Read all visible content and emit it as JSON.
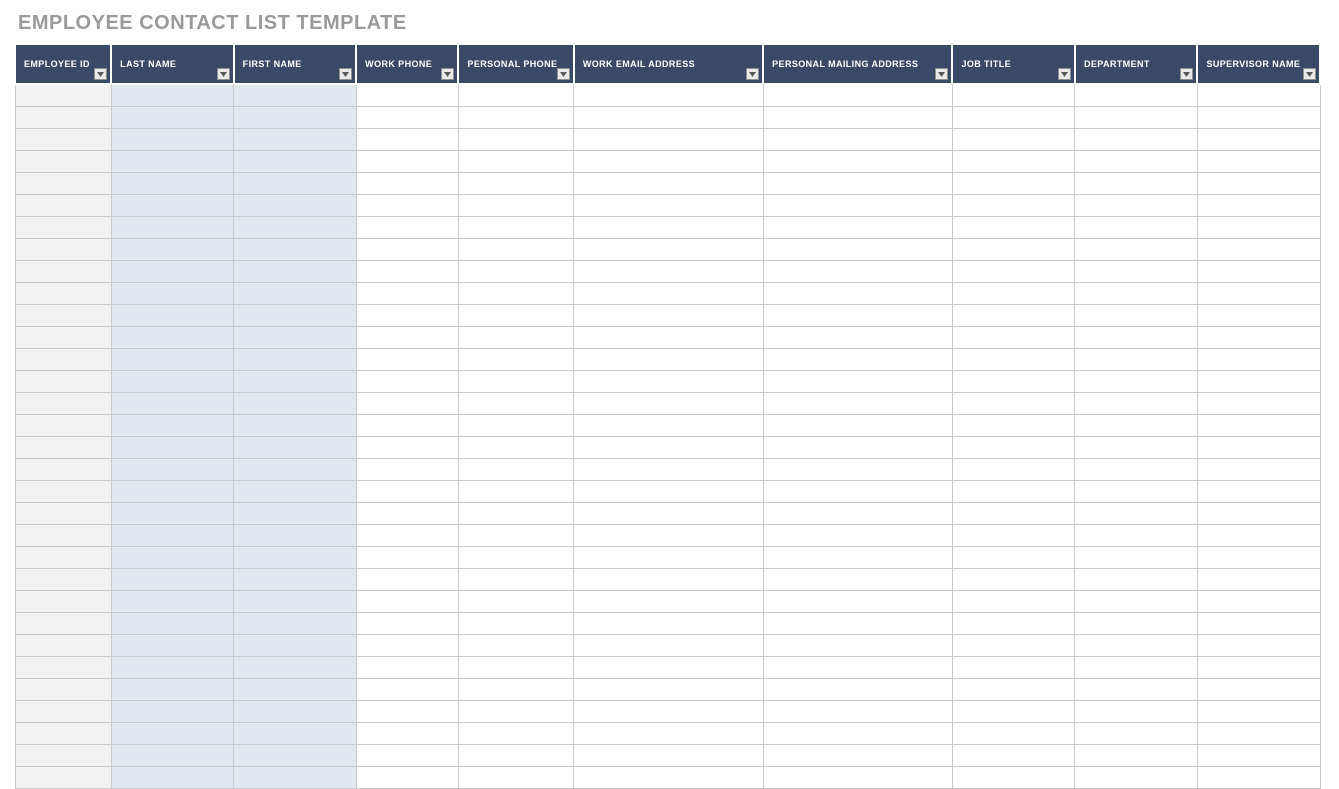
{
  "title": "EMPLOYEE CONTACT LIST TEMPLATE",
  "columns": [
    "EMPLOYEE ID",
    "LAST NAME",
    "FIRST NAME",
    "WORK PHONE",
    "PERSONAL PHONE",
    "WORK EMAIL ADDRESS",
    "PERSONAL MAILING ADDRESS",
    "JOB TITLE",
    "DEPARTMENT",
    "SUPERVISOR NAME"
  ],
  "row_count": 32,
  "shaded_columns": {
    "light_gray": [
      0
    ],
    "light_blue": [
      1,
      2
    ]
  }
}
